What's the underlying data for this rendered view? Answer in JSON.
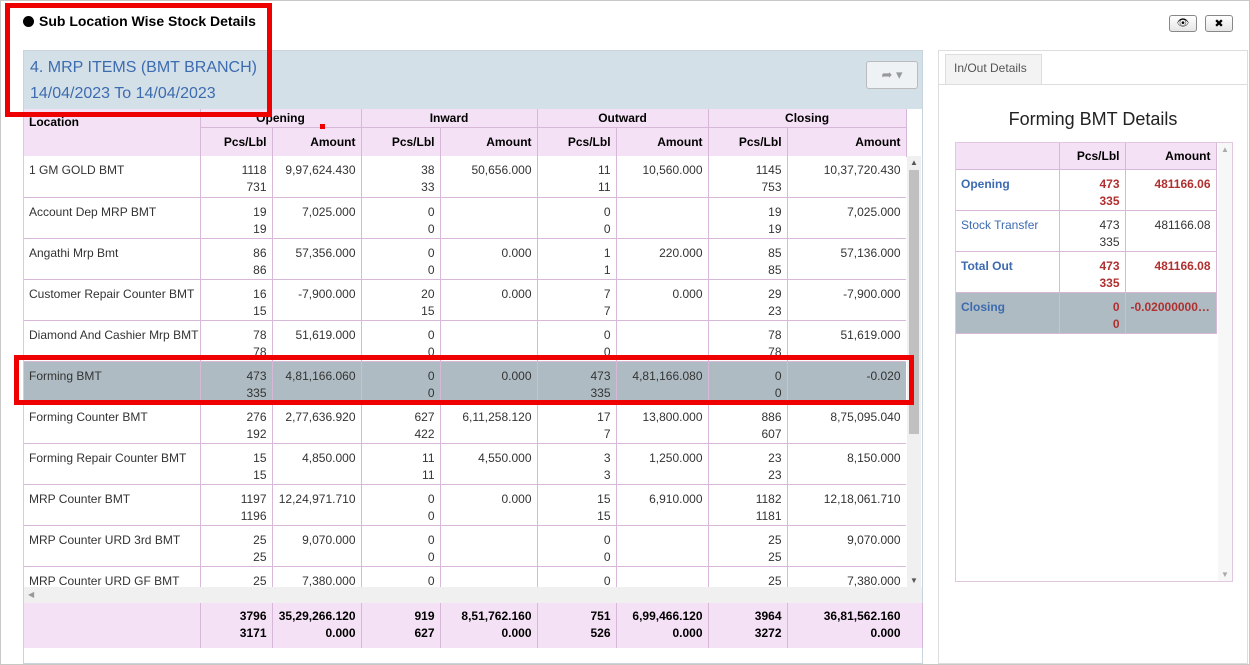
{
  "dialog": {
    "title": "Sub Location Wise Stock Details",
    "eye_icon": "eye-slash-icon",
    "close_icon": "close-icon",
    "close_glyph": "✖",
    "eye_glyph": "👁"
  },
  "panel": {
    "title": "4. MRP ITEMS (BMT BRANCH)",
    "date_range": "14/04/2023 To 14/04/2023",
    "share_icon": "share-icon"
  },
  "grid": {
    "location_header": "Location",
    "groups": [
      "Opening",
      "Inward",
      "Outward",
      "Closing"
    ],
    "sub_headers": [
      "Pcs/Lbl",
      "Amount",
      "Pcs/Lbl",
      "Amount",
      "Pcs/Lbl",
      "Amount",
      "Pcs/Lbl",
      "Amount"
    ],
    "rows": [
      {
        "location": "1 GM GOLD BMT",
        "op_pcs": "1118",
        "op_lbl": "731",
        "op_amt": "9,97,624.430",
        "in_pcs": "38",
        "in_lbl": "33",
        "in_amt": "50,656.000",
        "out_pcs": "11",
        "out_lbl": "11",
        "out_amt": "10,560.000",
        "cl_pcs": "1145",
        "cl_lbl": "753",
        "cl_amt": "10,37,720.430"
      },
      {
        "location": "Account Dep MRP BMT",
        "op_pcs": "19",
        "op_lbl": "19",
        "op_amt": "7,025.000",
        "in_pcs": "0",
        "in_lbl": "0",
        "in_amt": "",
        "out_pcs": "0",
        "out_lbl": "0",
        "out_amt": "",
        "cl_pcs": "19",
        "cl_lbl": "19",
        "cl_amt": "7,025.000"
      },
      {
        "location": "Angathi Mrp Bmt",
        "op_pcs": "86",
        "op_lbl": "86",
        "op_amt": "57,356.000",
        "in_pcs": "0",
        "in_lbl": "0",
        "in_amt": "0.000",
        "out_pcs": "1",
        "out_lbl": "1",
        "out_amt": "220.000",
        "cl_pcs": "85",
        "cl_lbl": "85",
        "cl_amt": "57,136.000"
      },
      {
        "location": "Customer Repair Counter BMT",
        "op_pcs": "16",
        "op_lbl": "15",
        "op_amt": "-7,900.000",
        "in_pcs": "20",
        "in_lbl": "15",
        "in_amt": "0.000",
        "out_pcs": "7",
        "out_lbl": "7",
        "out_amt": "0.000",
        "cl_pcs": "29",
        "cl_lbl": "23",
        "cl_amt": "-7,900.000"
      },
      {
        "location": "Diamond And Cashier Mrp BMT",
        "op_pcs": "78",
        "op_lbl": "78",
        "op_amt": "51,619.000",
        "in_pcs": "0",
        "in_lbl": "0",
        "in_amt": "",
        "out_pcs": "0",
        "out_lbl": "0",
        "out_amt": "",
        "cl_pcs": "78",
        "cl_lbl": "78",
        "cl_amt": "51,619.000"
      },
      {
        "location": "Forming BMT",
        "op_pcs": "473",
        "op_lbl": "335",
        "op_amt": "4,81,166.060",
        "in_pcs": "0",
        "in_lbl": "0",
        "in_amt": "0.000",
        "out_pcs": "473",
        "out_lbl": "335",
        "out_amt": "4,81,166.080",
        "cl_pcs": "0",
        "cl_lbl": "0",
        "cl_amt": "-0.020"
      },
      {
        "location": "Forming Counter BMT",
        "op_pcs": "276",
        "op_lbl": "192",
        "op_amt": "2,77,636.920",
        "in_pcs": "627",
        "in_lbl": "422",
        "in_amt": "6,11,258.120",
        "out_pcs": "17",
        "out_lbl": "7",
        "out_amt": "13,800.000",
        "cl_pcs": "886",
        "cl_lbl": "607",
        "cl_amt": "8,75,095.040"
      },
      {
        "location": "Forming Repair Counter BMT",
        "op_pcs": "15",
        "op_lbl": "15",
        "op_amt": "4,850.000",
        "in_pcs": "11",
        "in_lbl": "11",
        "in_amt": "4,550.000",
        "out_pcs": "3",
        "out_lbl": "3",
        "out_amt": "1,250.000",
        "cl_pcs": "23",
        "cl_lbl": "23",
        "cl_amt": "8,150.000"
      },
      {
        "location": "MRP Counter BMT",
        "op_pcs": "1197",
        "op_lbl": "1196",
        "op_amt": "12,24,971.710",
        "in_pcs": "0",
        "in_lbl": "0",
        "in_amt": "0.000",
        "out_pcs": "15",
        "out_lbl": "15",
        "out_amt": "6,910.000",
        "cl_pcs": "1182",
        "cl_lbl": "1181",
        "cl_amt": "12,18,061.710"
      },
      {
        "location": "MRP Counter URD 3rd BMT",
        "op_pcs": "25",
        "op_lbl": "25",
        "op_amt": "9,070.000",
        "in_pcs": "0",
        "in_lbl": "0",
        "in_amt": "",
        "out_pcs": "0",
        "out_lbl": "0",
        "out_amt": "",
        "cl_pcs": "25",
        "cl_lbl": "25",
        "cl_amt": "9,070.000"
      },
      {
        "location": "MRP Counter URD GF BMT",
        "op_pcs": "25",
        "op_lbl": "",
        "op_amt": "7,380.000",
        "in_pcs": "0",
        "in_lbl": "",
        "in_amt": "",
        "out_pcs": "0",
        "out_lbl": "",
        "out_amt": "",
        "cl_pcs": "25",
        "cl_lbl": "",
        "cl_amt": "7,380.000"
      }
    ],
    "totals": {
      "op_pcs": "3796",
      "op_lbl": "3171",
      "op_amt": "35,29,266.120",
      "op_amt2": "0.000",
      "in_pcs": "919",
      "in_lbl": "627",
      "in_amt": "8,51,762.160",
      "in_amt2": "0.000",
      "out_pcs": "751",
      "out_lbl": "526",
      "out_amt": "6,99,466.120",
      "out_amt2": "0.000",
      "cl_pcs": "3964",
      "cl_lbl": "3272",
      "cl_amt": "36,81,562.160",
      "cl_amt2": "0.000"
    }
  },
  "side": {
    "tab_label": "In/Out Details",
    "title": "Forming BMT Details",
    "headers": [
      "",
      "Pcs/Lbl",
      "Amount"
    ],
    "rows": [
      {
        "label": "Opening",
        "pcs": "473",
        "lbl": "335",
        "amount": "481166.06"
      },
      {
        "label": "Stock Transfer",
        "pcs": "473",
        "lbl": "335",
        "amount": "481166.08"
      },
      {
        "label": "Total Out",
        "pcs": "473",
        "lbl": "335",
        "amount": "481166.08"
      },
      {
        "label": "Closing",
        "pcs": "0",
        "lbl": "0",
        "amount": "-0.020000000000"
      }
    ]
  },
  "colors": {
    "header_bg": "#f5e1f5",
    "selected_row_bg": "#aebbc2",
    "title_blue": "#3d6bb0",
    "highlight_red": "#ee0000"
  }
}
